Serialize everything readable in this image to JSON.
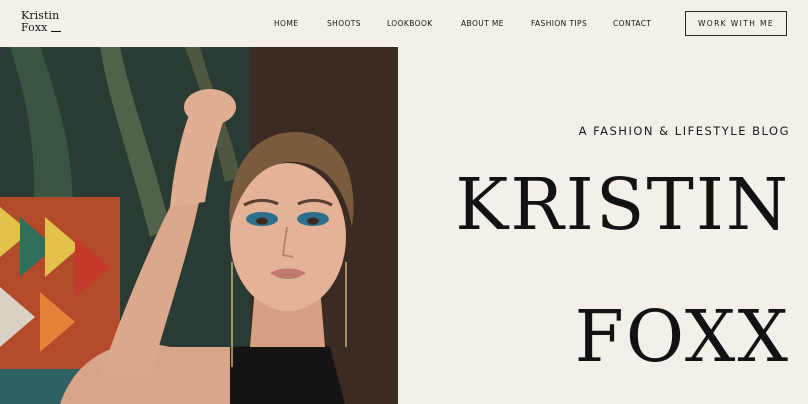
{
  "header": {
    "logo_line1": "Kristin",
    "logo_line2": "Foxx",
    "nav": [
      "HOME",
      "SHOOTS",
      "LOOKBOOK",
      "ABOUT ME",
      "FASHION TIPS",
      "CONTACT"
    ],
    "cta_label": "WORK WITH ME"
  },
  "hero": {
    "tagline": "A FASHION & LIFESTYLE BLOG",
    "name_line1": "KRISTIN",
    "name_line2": "FOXX"
  },
  "colors": {
    "background": "#f5efe9",
    "text": "#151515",
    "accent_eyeshadow": "#2f6f8e"
  }
}
